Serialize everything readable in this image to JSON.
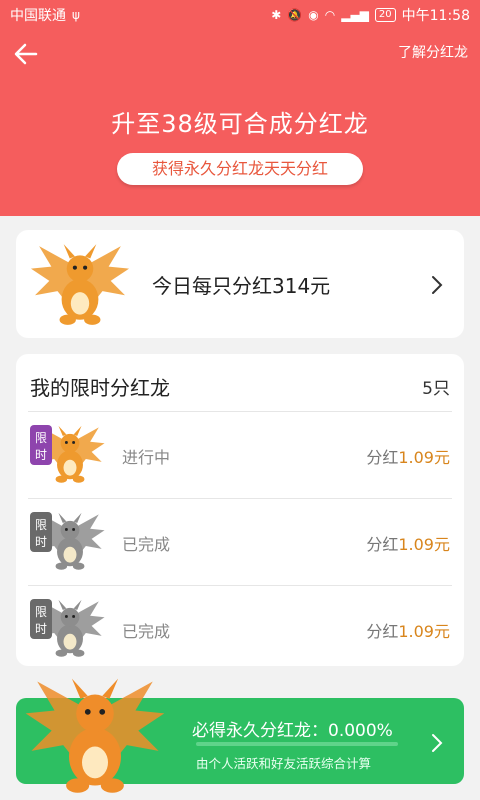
{
  "status_bar": {
    "carrier": "中国联通",
    "battery": "20",
    "time": "中午11:58"
  },
  "header": {
    "learn_link": "了解分红龙",
    "title": "升至38级可合成分红龙",
    "pill": "获得永久分红龙天天分红"
  },
  "today_card": {
    "text": "今日每只分红314元"
  },
  "my_dragons": {
    "title": "我的限时分红龙",
    "count": "5只",
    "badge_text": "限时",
    "rows": [
      {
        "status": "进行中",
        "share_label": "分红",
        "amount": "1.09元"
      },
      {
        "status": "已完成",
        "share_label": "分红",
        "amount": "1.09元"
      },
      {
        "status": "已完成",
        "share_label": "分红",
        "amount": "1.09元"
      }
    ]
  },
  "permanent": {
    "label": "必得永久分红龙：0.000%",
    "progress": 0.0,
    "note": "由个人活跃和好友活跃综合计算"
  },
  "colors": {
    "header": "#f55d5d",
    "accent_amount": "#d8851c",
    "green_card": "#2dbf62",
    "pill_text": "#e8573d"
  }
}
